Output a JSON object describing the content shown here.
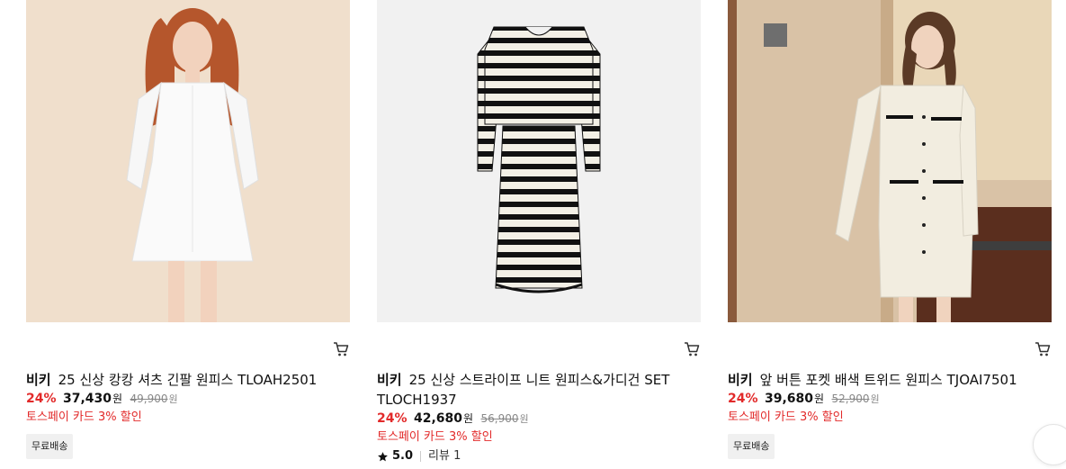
{
  "products": [
    {
      "brand": "비키",
      "name": "25 신상 캉캉 셔츠 긴팔 원피스 TLOAH2501",
      "discount": "24%",
      "price": "37,430",
      "currency": "원",
      "original_price": "49,900",
      "promo": "토스페이 카드 3% 할인",
      "badge": "무료배송"
    },
    {
      "brand": "비키",
      "name": "25 신상 스트라이프 니트 원피스&가디건 SET TLOCH1937",
      "discount": "24%",
      "price": "42,680",
      "currency": "원",
      "original_price": "56,900",
      "promo": "토스페이 카드 3% 할인",
      "rating": "5.0",
      "review": "리뷰 1"
    },
    {
      "brand": "비키",
      "name": "앞 버튼 포켓 배색 트위드 원피스 TJOAI7501",
      "discount": "24%",
      "price": "39,680",
      "currency": "원",
      "original_price": "52,900",
      "promo": "토스페이 카드 3% 할인",
      "badge": "무료배송"
    }
  ],
  "colors": {
    "discount_red": "#e22a2a",
    "photo1_bg": "#eedcc8",
    "photo2_bg": "#f1f1f1",
    "photo3_bg": "#d9c2a6"
  },
  "icons": {
    "cart": "cart-icon",
    "star": "star-icon"
  }
}
